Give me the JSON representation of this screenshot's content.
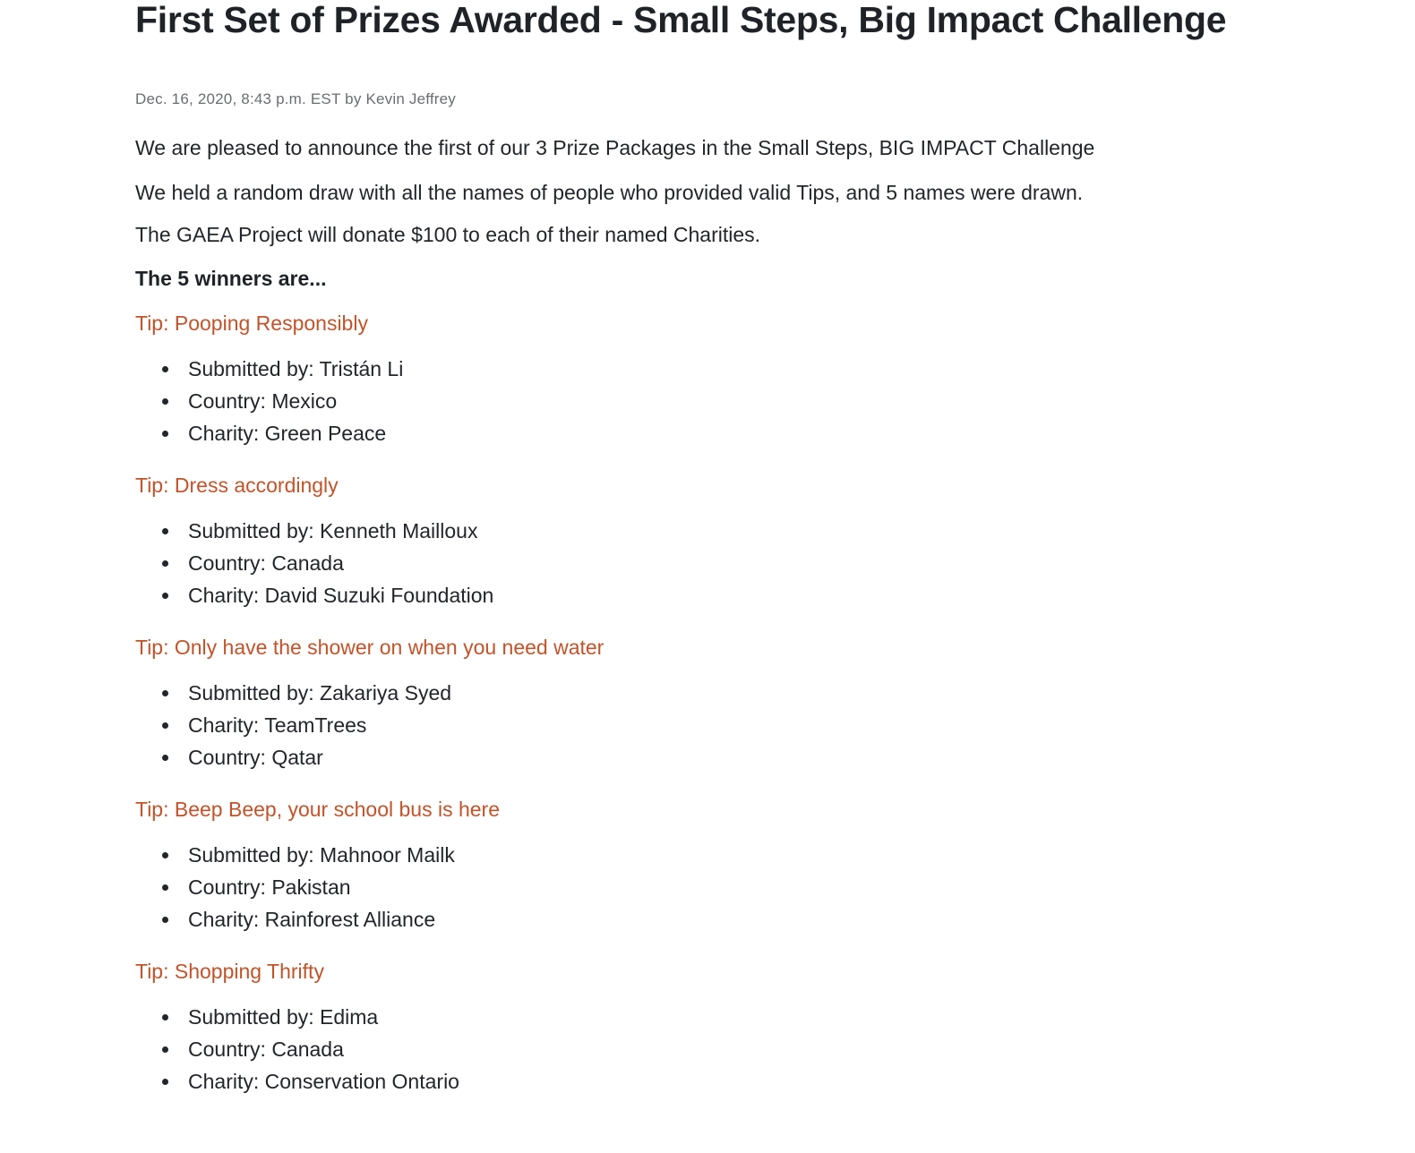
{
  "article": {
    "title": "First Set of Prizes Awarded - Small Steps, Big Impact Challenge",
    "byline": "Dec. 16, 2020, 8:43 p.m. EST by Kevin Jeffrey",
    "paragraphs": [
      "We are pleased to announce the first of our 3 Prize Packages in the Small Steps, BIG IMPACT Challenge",
      "We held a random draw with all the names of people who provided valid Tips, and 5 names were drawn.",
      "The GAEA Project will donate $100 to each of their named Charities."
    ],
    "winners_heading": "The 5 winners are...",
    "tips": [
      {
        "title": "Tip: Pooping Responsibly",
        "details": [
          "Submitted by: Tristán Li",
          "Country: Mexico",
          "Charity: Green Peace"
        ]
      },
      {
        "title": "Tip: Dress accordingly",
        "details": [
          "Submitted by: Kenneth Mailloux",
          "Country: Canada",
          "Charity: David Suzuki Foundation"
        ]
      },
      {
        "title": "Tip: Only have the shower on when you need water",
        "details": [
          "Submitted by: Zakariya Syed",
          "Charity: TeamTrees",
          "Country: Qatar"
        ]
      },
      {
        "title": "Tip: Beep Beep, your school bus is here",
        "details": [
          "Submitted by: Mahnoor Mailk",
          "Country: Pakistan",
          "Charity: Rainforest Alliance"
        ]
      },
      {
        "title": "Tip: Shopping Thrifty",
        "details": [
          "Submitted by: Edima",
          "Country: Canada",
          "Charity: Conservation Ontario"
        ]
      }
    ]
  },
  "colors": {
    "text": "#22252a",
    "byline": "#6a6d72",
    "tip_title": "#c2532a",
    "background": "#ffffff"
  }
}
